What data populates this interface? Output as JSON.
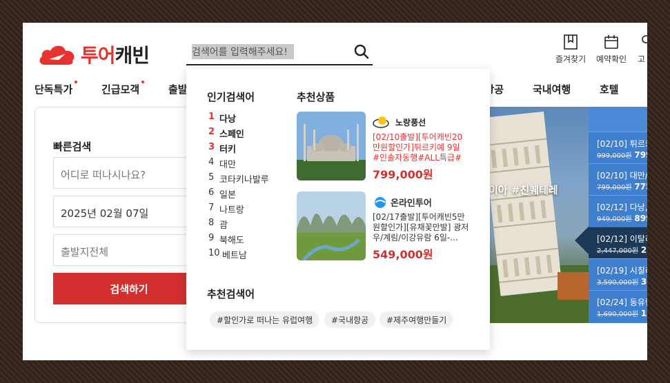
{
  "header": {
    "logo_text_red": "투어",
    "logo_text_dark": "캐빈",
    "search_placeholder": "검색어를 입력해주세요!",
    "utils": [
      {
        "label": "즐겨찾기",
        "icon": "bookmark-icon"
      },
      {
        "label": "예약확인",
        "icon": "calendar-icon"
      },
      {
        "label": "고",
        "icon": "customer-icon"
      }
    ]
  },
  "nav": {
    "items": [
      {
        "label": "단독특가",
        "dot": true
      },
      {
        "label": "긴급모객",
        "dot": true
      },
      {
        "label": "출발"
      },
      {
        "label": "항공"
      },
      {
        "label": "국내여행"
      },
      {
        "label": "호텔"
      }
    ]
  },
  "quick_search": {
    "title": "빠른검색",
    "destination_placeholder": "어디로 떠나시나요?",
    "date_value": "2025년  02월  07일",
    "departure_placeholder": "출발지전체",
    "submit_label": "검색하기"
  },
  "hero": {
    "caption": "이아 #친퀘테레"
  },
  "side_deals": [
    {
      "title": "[02/10] 튀르키",
      "old_price": "999,000원",
      "new_price": "799"
    },
    {
      "title": "[02/10] 대만/",
      "old_price": "799,000원",
      "new_price": "775"
    },
    {
      "title": "[02/12] 다낭,",
      "old_price": "949,000원",
      "new_price": "899"
    },
    {
      "title": "[02/12] 이탈리",
      "old_price": "2,447,000원",
      "new_price": "2,"
    },
    {
      "title": "[02/19] 시칠리",
      "old_price": "3,590,000원",
      "new_price": "3,"
    },
    {
      "title": "[02/24] 동유럽",
      "old_price": "1,690,000원",
      "new_price": "1,5"
    }
  ],
  "dropdown": {
    "popular_title": "인기검색어",
    "popular": [
      {
        "rank": "1",
        "term": "다낭"
      },
      {
        "rank": "2",
        "term": "스페인"
      },
      {
        "rank": "3",
        "term": "터키"
      },
      {
        "rank": "4",
        "term": "대만"
      },
      {
        "rank": "5",
        "term": "코타키나발루"
      },
      {
        "rank": "6",
        "term": "일본"
      },
      {
        "rank": "7",
        "term": "나트랑"
      },
      {
        "rank": "8",
        "term": "괌"
      },
      {
        "rank": "9",
        "term": "북해도"
      },
      {
        "rank": "10",
        "term": "베트남"
      }
    ],
    "recommended_title": "추천상품",
    "products": [
      {
        "brand": "노랑풍선",
        "desc": "[02/10출발][투어캐빈20만원할인가]튀르키예 9일 #인솔자동행#ALL특급#월...",
        "price": "799,000원",
        "desc_color": "#e8322f"
      },
      {
        "brand": "온라인투어",
        "desc": "[02/17출발][투어캐빈5만원할인가][유채꽃만발] 광저우/계림/이강유람 6일-...",
        "price": "549,000원",
        "desc_color": "#333333"
      }
    ],
    "keywords_title": "추천검색어",
    "keywords": [
      "#할인가로 떠나는 유럽여행",
      "#국내항공",
      "#제주여행만들기"
    ]
  },
  "colors": {
    "accent_red": "#e8322f",
    "button_red": "#d32f2f",
    "side_blue": "#3f7fd0",
    "side_dark": "#1c3a57"
  }
}
